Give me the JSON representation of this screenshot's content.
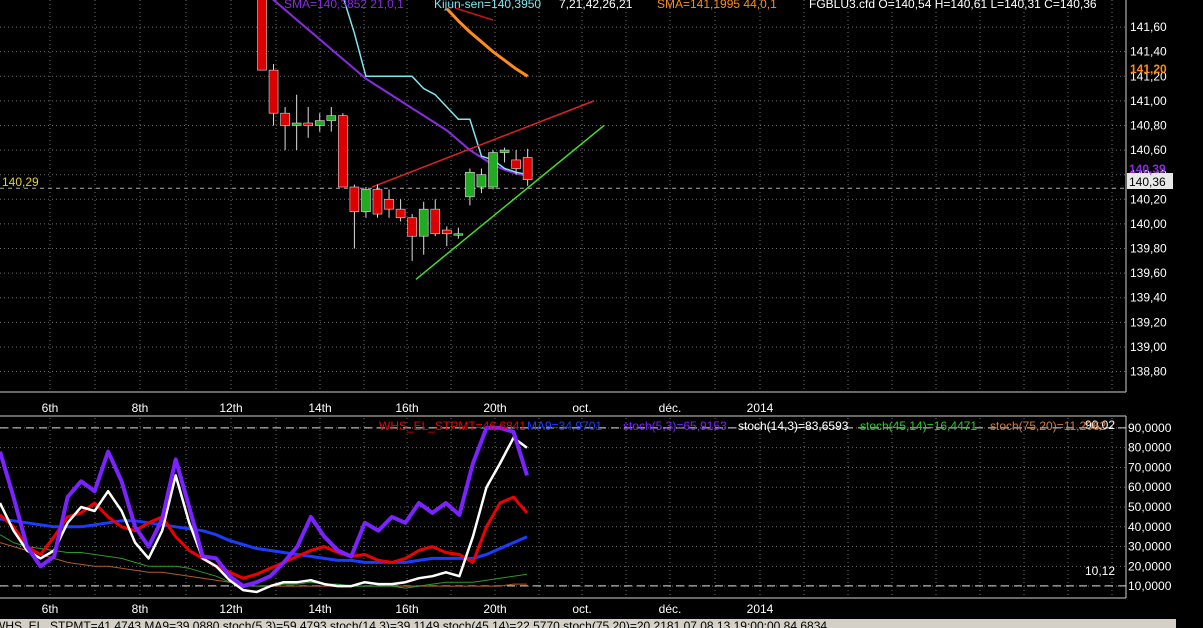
{
  "colors": {
    "background": "#000000",
    "grid": "#6e6e6e",
    "panel_border": "#d4d0c8",
    "candle_up": "#22aa22",
    "candle_down": "#dd0000",
    "sma_purple": "#8a2be2",
    "kijun_cyan": "#7fe6f0",
    "sma_orange": "#ff8c1a",
    "trend_red": "#dd2222",
    "trend_green": "#44dd22",
    "stoch_purple": "#7a22ff",
    "stoch_white": "#ffffff",
    "stoch_red": "#ee0000",
    "stoch_blue": "#1a3cff",
    "stoch_green": "#2a9a2a",
    "stoch_orange": "#b05a2a"
  },
  "header": {
    "sma1_text": "SMA=140,3852  21,0,1",
    "kijun_text": "Kijun-sen=140,3950",
    "ichimoku_params": "7,21,42,26,21",
    "sma2_text": "SMA=141,1995  44,0,1",
    "ohlc_text": "FGBLU3.cfd O=140,54 H=140,61 L=140,31 C=140,36"
  },
  "price_panel": {
    "left_level_label": "140,29",
    "last_price_label": "140,36",
    "orange_level_label": "141,20",
    "purple_level_label": "140,39"
  },
  "oscillator_panel": {
    "legend_red": "WHS_EL_STPMT=46,6841",
    "legend_blue": "MA9=34,9701",
    "legend_purple": "stoch(5,3)=65,9153",
    "legend_white": "stoch(14,3)=83,6593",
    "legend_green": "stoch(45,14)=16,4471",
    "legend_orange": "stoch(75,20)=11,2062",
    "upper_level_label": "90,02",
    "lower_level_label": "10,12",
    "yticks": [
      "90,0000",
      "80,0000",
      "70,0000",
      "60,0000",
      "50,0000",
      "40,0000",
      "30,0000",
      "20,0000",
      "10,0000"
    ]
  },
  "status_bar": {
    "text": "WHS_EL_STPMT=41,4743 MA9=39,0880 stoch(5,3)=59,4793 stoch(14,3)=39,1149 stoch(45,14)=22,5770 stoch(75,20)=20,2181  07.08.13 19:00:00 84,6834"
  },
  "chart_data": [
    {
      "type": "candlestick",
      "title": "FGBLU3.cfd",
      "ylim": [
        138.65,
        141.82
      ],
      "yticks": [
        "141,60",
        "141,40",
        "141,20",
        "141,00",
        "140,80",
        "140,60",
        "140,40",
        "140,20",
        "140,00",
        "139,80",
        "139,60",
        "139,40",
        "139,20",
        "139,00",
        "138,80"
      ],
      "xticks": [
        "6th",
        "8th",
        "12th",
        "14th",
        "16th",
        "20th",
        "oct.",
        "déc.",
        "2014"
      ],
      "candles": [
        {
          "o": 141.85,
          "h": 141.85,
          "l": 141.25,
          "c": 141.25
        },
        {
          "o": 141.25,
          "h": 141.3,
          "l": 140.8,
          "c": 140.9
        },
        {
          "o": 140.9,
          "h": 140.95,
          "l": 140.6,
          "c": 140.8
        },
        {
          "o": 140.8,
          "h": 141.05,
          "l": 140.6,
          "c": 140.82
        },
        {
          "o": 140.82,
          "h": 140.95,
          "l": 140.7,
          "c": 140.8
        },
        {
          "o": 140.8,
          "h": 140.9,
          "l": 140.75,
          "c": 140.84
        },
        {
          "o": 140.84,
          "h": 140.95,
          "l": 140.75,
          "c": 140.88
        },
        {
          "o": 140.88,
          "h": 140.9,
          "l": 140.3,
          "c": 140.3
        },
        {
          "o": 140.3,
          "h": 140.32,
          "l": 139.8,
          "c": 140.1
        },
        {
          "o": 140.1,
          "h": 140.3,
          "l": 140.05,
          "c": 140.28
        },
        {
          "o": 140.28,
          "h": 140.32,
          "l": 140.05,
          "c": 140.08
        },
        {
          "o": 140.2,
          "h": 140.28,
          "l": 140.05,
          "c": 140.12
        },
        {
          "o": 140.12,
          "h": 140.2,
          "l": 140.02,
          "c": 140.05
        },
        {
          "o": 140.05,
          "h": 140.08,
          "l": 139.7,
          "c": 139.9
        },
        {
          "o": 139.9,
          "h": 140.18,
          "l": 139.75,
          "c": 140.12
        },
        {
          "o": 140.12,
          "h": 140.2,
          "l": 139.9,
          "c": 139.92
        },
        {
          "o": 139.95,
          "h": 139.98,
          "l": 139.82,
          "c": 139.92
        },
        {
          "o": 139.92,
          "h": 139.97,
          "l": 139.88,
          "c": 139.92
        },
        {
          "o": 140.22,
          "h": 140.45,
          "l": 140.15,
          "c": 140.42
        },
        {
          "o": 140.3,
          "h": 140.45,
          "l": 140.25,
          "c": 140.4
        },
        {
          "o": 140.3,
          "h": 140.6,
          "l": 140.28,
          "c": 140.58
        },
        {
          "o": 140.58,
          "h": 140.62,
          "l": 140.5,
          "c": 140.6
        },
        {
          "o": 140.52,
          "h": 140.6,
          "l": 140.4,
          "c": 140.45
        },
        {
          "o": 140.54,
          "h": 140.61,
          "l": 140.31,
          "c": 140.36
        }
      ],
      "series": [
        {
          "name": "SMA 21",
          "values": [
            141.9,
            141.82,
            141.74,
            141.66,
            141.58,
            141.5,
            141.42,
            141.34,
            141.26,
            141.18,
            141.12,
            141.06,
            141.0,
            140.94,
            140.88,
            140.82,
            140.76,
            140.68,
            140.6,
            140.54,
            140.48,
            140.44,
            140.41,
            140.39
          ]
        },
        {
          "name": "Kijun-sen",
          "values": [
            141.85,
            141.85,
            141.85,
            141.85,
            141.85,
            141.85,
            141.85,
            141.85,
            141.55,
            141.2,
            141.2,
            141.2,
            141.2,
            141.2,
            141.1,
            141.05,
            140.95,
            140.85,
            140.85,
            140.55,
            140.52,
            140.45,
            140.42,
            140.4
          ]
        },
        {
          "name": "SMA 44",
          "values": [
            null,
            null,
            null,
            null,
            null,
            null,
            null,
            null,
            null,
            null,
            null,
            null,
            null,
            null,
            null,
            null,
            141.75,
            141.65,
            141.56,
            141.48,
            141.4,
            141.33,
            141.26,
            141.2
          ]
        },
        {
          "name": "Trend red",
          "values": [
            140.3,
            141.0
          ]
        },
        {
          "name": "Trend green",
          "values": [
            139.55,
            140.8
          ]
        }
      ]
    },
    {
      "type": "line",
      "ylim": [
        5,
        95
      ],
      "reference_levels": [
        90.02,
        10.12
      ],
      "series": [
        {
          "name": "WHS_EL_STPMT",
          "values": [
            46,
            40,
            30,
            26,
            35,
            45,
            47,
            52,
            45,
            40,
            38,
            42,
            45,
            35,
            28,
            24,
            20,
            17,
            14,
            16,
            19,
            22,
            25,
            28,
            30,
            27,
            25,
            26,
            23,
            22,
            24,
            28,
            30,
            27,
            26,
            22,
            40,
            52,
            55,
            47
          ]
        },
        {
          "name": "MA9",
          "values": [
            44,
            43,
            42,
            41,
            40,
            40,
            40,
            41,
            42,
            43,
            43,
            42,
            41,
            40,
            39,
            38,
            36,
            33,
            31,
            29,
            28,
            27,
            26,
            25,
            24,
            23,
            23,
            22,
            22,
            22,
            22,
            23,
            24,
            24,
            24,
            24,
            26,
            29,
            32,
            35
          ]
        },
        {
          "name": "stoch(5,3)",
          "values": [
            78,
            55,
            30,
            20,
            25,
            55,
            63,
            58,
            78,
            63,
            40,
            30,
            44,
            74,
            50,
            25,
            24,
            15,
            10,
            12,
            15,
            22,
            30,
            45,
            35,
            28,
            25,
            42,
            38,
            45,
            42,
            52,
            47,
            52,
            46,
            72,
            90,
            90,
            88,
            66
          ]
        },
        {
          "name": "stoch(14,3)",
          "values": [
            52,
            38,
            28,
            24,
            28,
            42,
            50,
            48,
            58,
            48,
            32,
            24,
            38,
            66,
            42,
            24,
            20,
            13,
            8,
            7,
            10,
            12,
            12,
            13,
            11,
            10,
            10,
            12,
            11,
            11,
            12,
            14,
            15,
            17,
            15,
            35,
            60,
            72,
            85,
            80
          ]
        },
        {
          "name": "stoch(45,14)",
          "values": [
            36,
            32,
            30,
            29,
            28,
            27,
            27,
            26,
            25,
            24,
            22,
            20,
            20,
            20,
            19,
            17,
            15,
            12,
            10,
            10,
            10,
            11,
            11,
            12,
            11,
            11,
            10,
            10,
            10,
            10,
            9,
            10,
            11,
            12,
            12,
            12,
            13,
            14,
            15,
            16
          ]
        },
        {
          "name": "stoch(75,20)",
          "values": [
            32,
            30,
            28,
            26,
            24,
            22,
            21,
            20,
            20,
            19,
            18,
            17,
            17,
            16,
            15,
            14,
            13,
            12,
            11,
            10,
            10,
            10,
            10,
            10,
            10,
            10,
            10,
            10,
            10,
            10,
            10,
            10,
            10,
            10,
            10,
            10,
            10,
            10,
            11,
            11
          ]
        }
      ]
    }
  ]
}
